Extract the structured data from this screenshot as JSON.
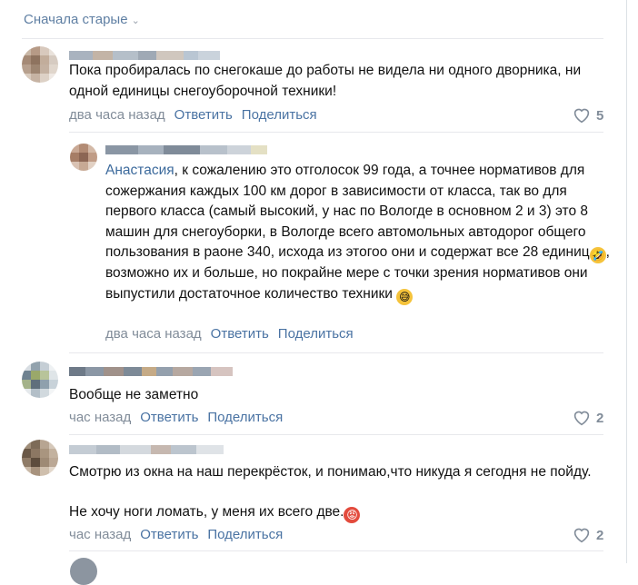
{
  "sort": {
    "label": "Сначала старые"
  },
  "comments": [
    {
      "text": "Пока пробиралась по снегокаше до работы не видела ни одного дворника, ни одной единицы снегоуборочной техники!",
      "time": "два часа назад",
      "reply": "Ответить",
      "share": "Поделиться",
      "likes": "5"
    },
    {
      "mention": "Анастасия",
      "text_a": ", к сожалению это отголосок 99 года, а точнее нормативов для сожержания каждых 100 км дорог в зависимости от класса, так во для первого класса (самый высокий, у нас по Вологде в основном 2 и 3) это 8 машин для снегоуборки, в Вологде всего автомольных автодорог общего пользования в раоне 340, исхода из этогоо они и содержат все 28 единиц",
      "text_b": ", возможно их и больше, но покрайне мере с точки зрения нормативов они выпустили достаточное количество техники ",
      "time": "два часа назад",
      "reply": "Ответить",
      "share": "Поделиться"
    },
    {
      "text": "Вообще не заметно",
      "time": "час назад",
      "reply": "Ответить",
      "share": "Поделиться",
      "likes": "2"
    },
    {
      "text": "Смотрю из окна на наш перекрёсток, и понимаю,что никуда я сегодня не пойду.",
      "text2": "Не хочу ноги ломать, у меня их всего две.",
      "time": "час назад",
      "reply": "Ответить",
      "share": "Поделиться",
      "likes": "2"
    }
  ],
  "emojis": {
    "laugh": "🤣",
    "sweat": "😅",
    "angry": "😡"
  }
}
